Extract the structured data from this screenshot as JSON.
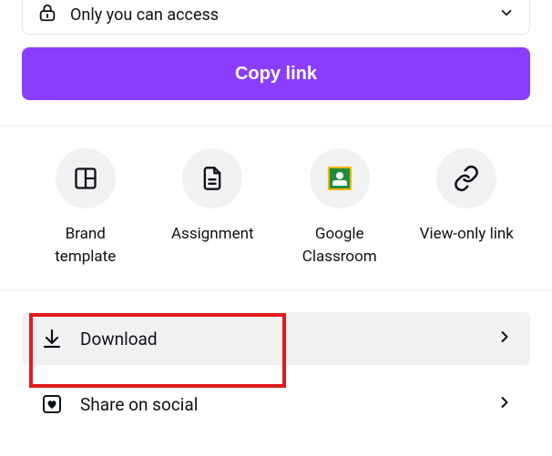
{
  "access": {
    "label": "Only you can access"
  },
  "copy_button": {
    "label": "Copy link"
  },
  "share_options": [
    {
      "label": "Brand\ntemplate"
    },
    {
      "label": "Assignment"
    },
    {
      "label": "Google\nClassroom"
    },
    {
      "label": "View-only link"
    }
  ],
  "actions": {
    "download": {
      "label": "Download"
    },
    "share_social": {
      "label": "Share on social"
    }
  }
}
